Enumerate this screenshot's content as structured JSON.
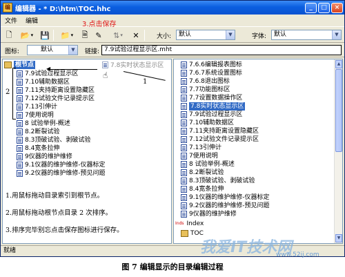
{
  "window": {
    "title": "编辑器 - * D:\\htm\\TOC.hhc",
    "app_icon": "编"
  },
  "title_buttons": {
    "minimize": "_",
    "maximize": "□",
    "close": "×"
  },
  "menu": [
    "文件",
    "编辑"
  ],
  "toolbar": {
    "save_annotation": "3.点击保存",
    "size_label": "大小:",
    "size_value": "默认",
    "font_label": "字体:",
    "font_value": "默认"
  },
  "toolbar2": {
    "icon_label": "图标:",
    "icon_value": "默认",
    "link_label": "链接:",
    "link_value": "7.9试验过程显示区.mht"
  },
  "left_tree": {
    "root": "根节点",
    "items": [
      "7.9试验过程显示区",
      "7.10辅助数据区",
      "7.11夹持距离设置隐藏区",
      "7.12试验文件记录提示区",
      "7.13引伸计",
      "7使用说明",
      "8 试验举例-概述",
      "8.2断裂试验",
      "8.3顶破试验、剥破试验",
      "8.4宽条拉伸",
      "9仪器的维护维修",
      "9.1仪器的维护维修-仪器标定",
      "9.2仪器的维护维修-预见问题"
    ],
    "drag_ghost": "7.8实时状态显示区"
  },
  "annotations": {
    "n1": "1",
    "n2": "2"
  },
  "instructions": [
    "1.用鼠标拖动目录索引到根节点。",
    "2.用鼠标拖动根节点目录 2 次排序。",
    "3.排序完毕别忘点击保存图标进行保存。"
  ],
  "right_tree": {
    "items": [
      "7.6.6编辑报表图标",
      "7.6.7系统设置图标",
      "7.6.8退出图标",
      "7.7功能图标区",
      "7.7设置数据操作区",
      "7.8实时状态显示区",
      "7.9试验过程显示区",
      "7.10辅助数据区",
      "7.11夹持距离设置隐藏区",
      "7.12试验文件记录提示区",
      "7.13引伸计",
      "7使用说明",
      "8 试验举例-概述",
      "8.2断裂试验",
      "8.3顶破试验、剥破试验",
      "8.4宽条拉伸",
      "9.1仪器的维护维修-仪器标定",
      "9.2仪器的维护维修-预见问题",
      "9仪器的维护维修"
    ],
    "selected_index": 5,
    "index_label": "Index",
    "index_tag": "Inds",
    "toc_label": "TOC"
  },
  "status": "就绪",
  "caption": "图 7  编辑显示的目录编辑过程",
  "watermark": "我爱IT技术网",
  "watermark_url": "www.52ij.com"
}
